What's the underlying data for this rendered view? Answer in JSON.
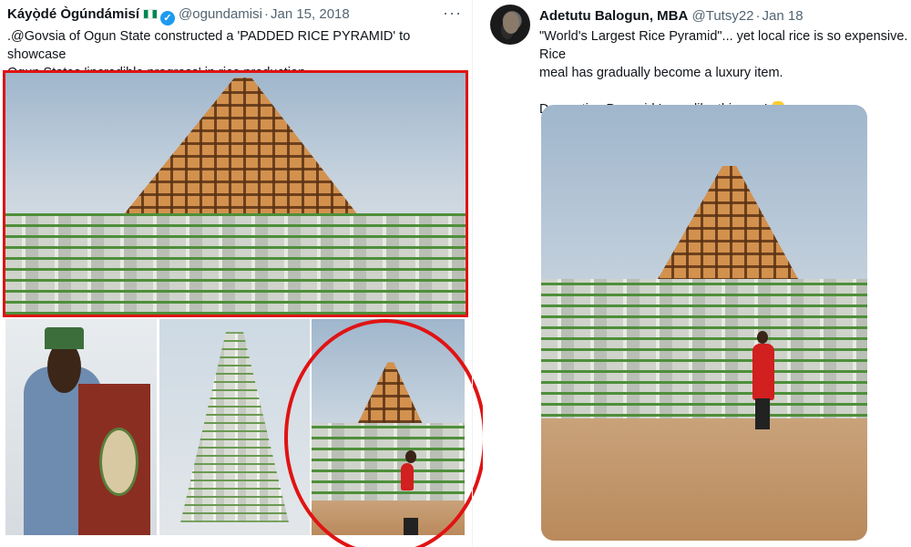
{
  "left_tweet": {
    "author_name": "Káyọ̀dé Ògúndámisí",
    "handle": "@ogundamisi",
    "date": "Jan 15, 2018",
    "text": ".@Govsia of Ogun State constructed a 'PADDED RICE PYRAMID' to showcase\nOgun States 'incredible progress' in rice production.",
    "more_icon": "···",
    "flag_icon": "nigeria-flag-icon",
    "verified_icon": "verified-badge-icon"
  },
  "right_tweet": {
    "author_name": "Adetutu Balogun, MBA",
    "handle": "@Tutsy22",
    "date": "Jan 18",
    "text": "\"World's Largest Rice Pyramid\"... yet local rice is so expensive. Rice\nmeal has gradually become a luxury item.\n\nDecorative Pyramid Isonu like this one!",
    "emoji_icon": "pointing-down-icon"
  },
  "colors": {
    "highlight_red": "#e01313",
    "verified_blue": "#1d9bf0",
    "secondary_text": "#536471"
  }
}
